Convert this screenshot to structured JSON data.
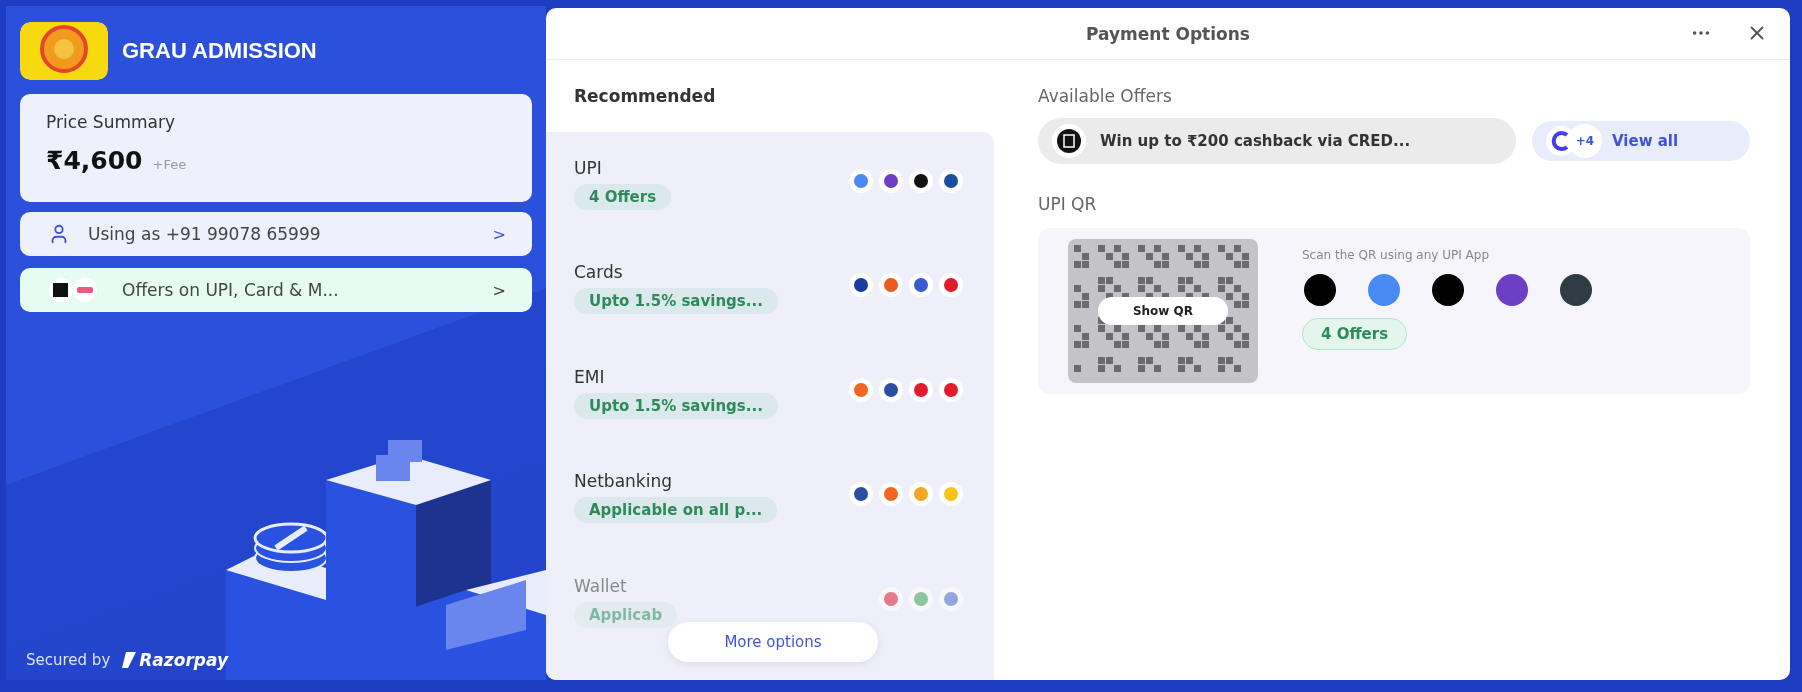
{
  "brand": {
    "title": "GRAU ADMISSION"
  },
  "price_summary": {
    "label": "Price Summary",
    "amount": "₹4,600",
    "fee_note": "+Fee"
  },
  "account": {
    "text": "Using as +91 99078 65999",
    "chevron": ">"
  },
  "offers_banner": {
    "text": "Offers on UPI, Card & M...",
    "chevron": ">"
  },
  "footer": {
    "secured_by": "Secured by",
    "brand": "Razorpay"
  },
  "modal": {
    "title": "Payment Options"
  },
  "recommended": {
    "heading": "Recommended",
    "methods": [
      {
        "name": "UPI",
        "offer": "4 Offers",
        "dimmed": false
      },
      {
        "name": "Cards",
        "offer": "Upto 1.5% savings...",
        "dimmed": false
      },
      {
        "name": "EMI",
        "offer": "Upto 1.5% savings...",
        "dimmed": false
      },
      {
        "name": "Netbanking",
        "offer": "Applicable on all p...",
        "dimmed": false
      },
      {
        "name": "Wallet",
        "offer": "Applicab",
        "dimmed": true
      }
    ],
    "more_button": "More options"
  },
  "available_offers": {
    "heading": "Available Offers",
    "offer": "Win up to ₹200 cashback via CRED...",
    "extra_count": "+4",
    "view_all": "View all"
  },
  "upi_qr": {
    "heading": "UPI QR",
    "show_button": "Show QR",
    "hint": "Scan the QR using any UPI App",
    "offers": "4 Offers"
  }
}
